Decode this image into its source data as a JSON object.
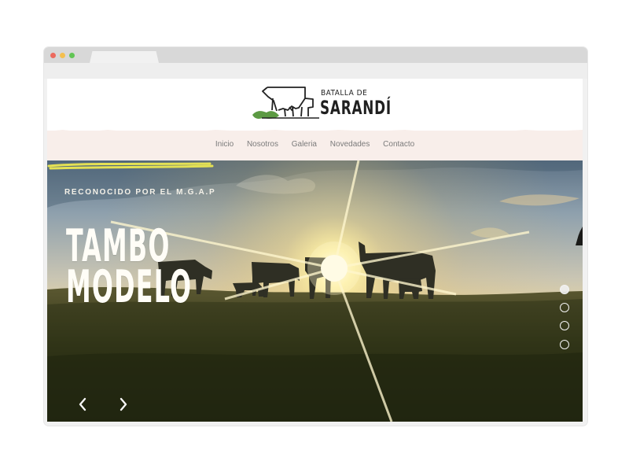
{
  "site": {
    "logo": {
      "line1": "BATALLA DE",
      "line2": "SARANDÍ",
      "icon": "cow-logo-icon"
    },
    "nav": [
      "Inicio",
      "Nosotros",
      "Galeria",
      "Novedades",
      "Contacto"
    ]
  },
  "hero": {
    "badge": "RECONOCIDO POR EL M.G.A.P",
    "title_line1": "TAMBO",
    "title_line2": "MODELO",
    "prev_icon": "chevron-left-icon",
    "next_icon": "chevron-right-icon"
  },
  "colors": {
    "nav_background": "#f8eeea",
    "nav_text": "#7b7b7b",
    "hero_text": "#fffdf7",
    "accent_underline": "#e4e154",
    "logo_green": "#5c9a43"
  }
}
